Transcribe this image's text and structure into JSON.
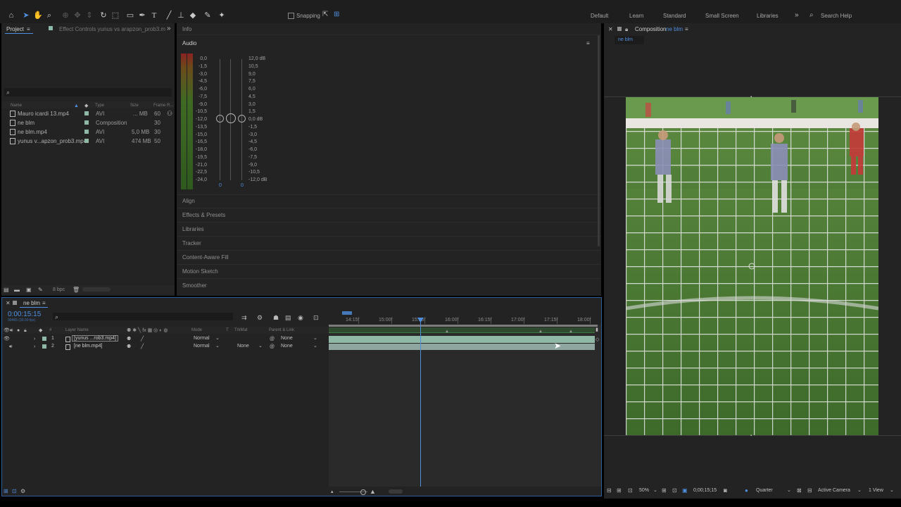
{
  "toolbar": {
    "snapping_label": "Snapping",
    "workspaces": [
      "Default",
      "Learn",
      "Standard",
      "Small Screen",
      "Libraries"
    ],
    "search_placeholder": "Search Help"
  },
  "project_panel": {
    "tab_project": "Project",
    "tab_effect_controls": "Effect Controls yunus vs arapzon_prob3.m",
    "columns": [
      "Name",
      "Type",
      "Size",
      "Frame R..."
    ],
    "items": [
      {
        "name": "Mauro icardi 13.mp4",
        "type": "AVI",
        "size": "... MB",
        "fps": "60"
      },
      {
        "name": "ne blm",
        "type": "Composition",
        "size": "",
        "fps": "30"
      },
      {
        "name": "ne blm.mp4",
        "type": "AVI",
        "size": "5,0 MB",
        "fps": "30"
      },
      {
        "name": "yunus v...apzon_prob3.mp4",
        "type": "AVI",
        "size": "474 MB",
        "fps": "50"
      }
    ],
    "bpc_label": "8 bpc"
  },
  "info_panel": {
    "title": "Info",
    "audio_title": "Audio",
    "meter_labels": [
      "0,0",
      "-1,5",
      "-3,0",
      "-4,5",
      "-6,0",
      "-7,5",
      "-9,0",
      "-10,5",
      "-12,0",
      "-13,5",
      "-15,0",
      "-16,5",
      "-18,0",
      "-19,5",
      "-21,0",
      "-22,5",
      "-24,0"
    ],
    "db_labels": [
      "12,0 dB",
      "10,5",
      "9,0",
      "7,5",
      "6,0",
      "4,5",
      "3,0",
      "1,5",
      "0,0 dB",
      "-1,5",
      "-3,0",
      "-4,5",
      "-6,0",
      "-7,5",
      "-9,0",
      "-10,5",
      "-12,0 dB"
    ],
    "left_value": "0",
    "right_value": "0",
    "accordion": [
      "Align",
      "Effects & Presets",
      "Libraries",
      "Tracker",
      "Content-Aware Fill",
      "Motion Sketch",
      "Smoother"
    ]
  },
  "composition_panel": {
    "title_prefix": "Composition",
    "title_comp": "ne blm",
    "tab": "ne blm",
    "zoom": "50%",
    "timecode": "0;00;15;15",
    "resolution": "Quarter",
    "camera": "Active Camera",
    "view": "1 View"
  },
  "timeline": {
    "tab": "ne blm",
    "timecode": "0:00:15:15",
    "frame_info": "00465 (30.00 fps)",
    "column_headers": {
      "layer_name": "Layer Name",
      "mode": "Mode",
      "t": "T",
      "trkmat": "TrkMat",
      "parent": "Parent & Link"
    },
    "ruler_ticks": [
      "14:15f",
      "15:00f",
      "15:15f",
      "16:00f",
      "16:15f",
      "17:00f",
      "17:15f",
      "18:00f"
    ],
    "playhead_fraction": 0.34,
    "layers": [
      {
        "index": "1",
        "name": "[yunus ...rob3.mp4]",
        "mode": "Normal",
        "trkmat": "",
        "parent": "None"
      },
      {
        "index": "2",
        "name": "[ne blm.mp4]",
        "mode": "Normal",
        "trkmat": "None",
        "parent": "None"
      }
    ]
  },
  "colors": {
    "accent": "#4f8fe0",
    "panel": "#232323",
    "layer_bar": "#8fb8a6",
    "pitch": "#4f7a36"
  }
}
